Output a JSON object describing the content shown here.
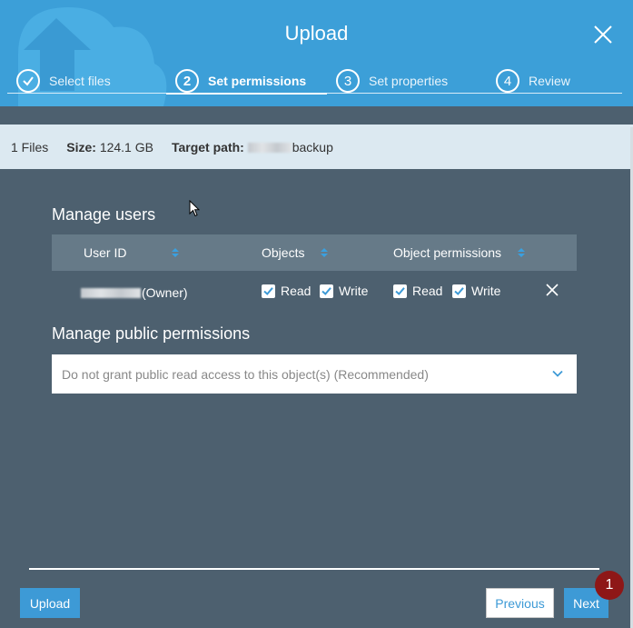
{
  "header": {
    "title": "Upload",
    "steps": [
      {
        "number": "",
        "label": "Select files",
        "state": "done"
      },
      {
        "number": "2",
        "label": "Set permissions",
        "state": "active"
      },
      {
        "number": "3",
        "label": "Set properties",
        "state": "pending"
      },
      {
        "number": "4",
        "label": "Review",
        "state": "pending"
      }
    ]
  },
  "summary": {
    "files": "1 Files",
    "size_label": "Size:",
    "size_value": "124.1 GB",
    "target_label": "Target path:",
    "target_value": "backup"
  },
  "manage_users": {
    "title": "Manage users",
    "columns": [
      "User ID",
      "Objects",
      "Object permissions"
    ],
    "row": {
      "user_suffix": "(Owner)",
      "objects_read": "Read",
      "objects_write": "Write",
      "perm_read": "Read",
      "perm_write": "Write"
    }
  },
  "public_permissions": {
    "title": "Manage public permissions",
    "selected": "Do not grant public read access to this object(s) (Recommended)"
  },
  "footer": {
    "upload": "Upload",
    "previous": "Previous",
    "next": "Next",
    "badge": "1"
  },
  "colors": {
    "header_blue": "#3c9fd8",
    "body_slate": "#4d606f",
    "primary_button": "#3d9ad6",
    "badge_red": "#8e1717"
  },
  "icons": [
    "check-circle-icon",
    "close-icon",
    "sort-icon",
    "checkbox-checked-icon",
    "remove-x-icon",
    "chevron-down-icon",
    "mouse-cursor-icon"
  ]
}
